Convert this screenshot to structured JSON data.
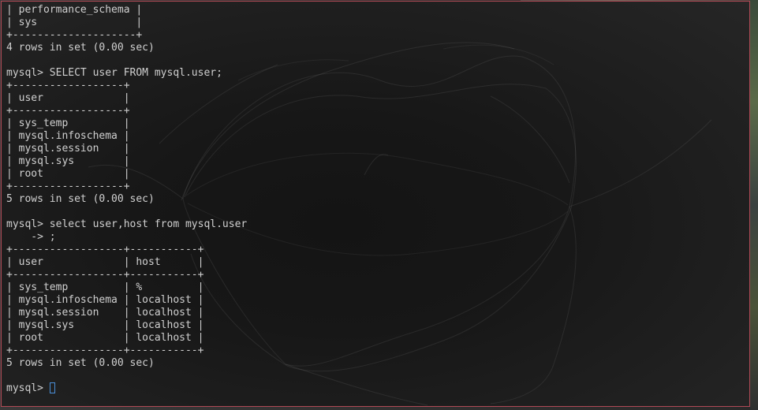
{
  "terminal": {
    "lines": [
      "| performance_schema |",
      "| sys                |",
      "+--------------------+",
      "4 rows in set (0.00 sec)",
      "",
      "mysql> SELECT user FROM mysql.user;",
      "+------------------+",
      "| user             |",
      "+------------------+",
      "| sys_temp         |",
      "| mysql.infoschema |",
      "| mysql.session    |",
      "| mysql.sys        |",
      "| root             |",
      "+------------------+",
      "5 rows in set (0.00 sec)",
      "",
      "mysql> select user,host from mysql.user",
      "    -> ;",
      "+------------------+-----------+",
      "| user             | host      |",
      "+------------------+-----------+",
      "| sys_temp         | %         |",
      "| mysql.infoschema | localhost |",
      "| mysql.session    | localhost |",
      "| mysql.sys        | localhost |",
      "| root             | localhost |",
      "+------------------+-----------+",
      "5 rows in set (0.00 sec)",
      ""
    ],
    "prompt": "mysql> ",
    "colors": {
      "text": "#d0d0d0",
      "cursor": "#4a8fd8",
      "border": "#b04a56"
    }
  }
}
